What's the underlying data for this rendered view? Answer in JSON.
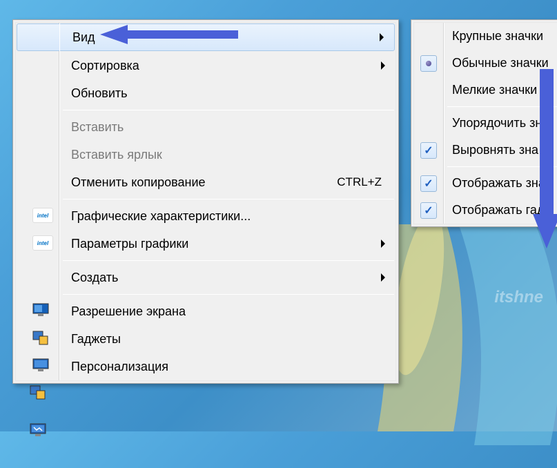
{
  "desktop_icons": {
    "intel1": "intel",
    "intel2": "intel"
  },
  "context_menu": {
    "items": [
      {
        "label": "Вид",
        "submenu": true,
        "highlighted": true
      },
      {
        "label": "Сортировка",
        "submenu": true
      },
      {
        "label": "Обновить"
      },
      {
        "separator": true
      },
      {
        "label": "Вставить",
        "disabled": true
      },
      {
        "label": "Вставить ярлык",
        "disabled": true
      },
      {
        "label": "Отменить копирование",
        "shortcut": "CTRL+Z"
      },
      {
        "separator": true
      },
      {
        "label": "Графические характеристики...",
        "icon": "intel"
      },
      {
        "label": "Параметры графики",
        "submenu": true,
        "icon": "intel"
      },
      {
        "separator": true
      },
      {
        "label": "Создать",
        "submenu": true
      },
      {
        "separator": true
      },
      {
        "label": "Разрешение экрана",
        "icon": "monitor-blue"
      },
      {
        "label": "Гаджеты",
        "icon": "gadgets"
      },
      {
        "label": "Персонализация",
        "icon": "personalize"
      }
    ]
  },
  "submenu": {
    "items": [
      {
        "label": "Крупные значки"
      },
      {
        "label": "Обычные значки",
        "radio": true
      },
      {
        "label": "Мелкие значки"
      },
      {
        "separator": true
      },
      {
        "label": "Упорядочить зн"
      },
      {
        "label": "Выровнять зна",
        "check": true
      },
      {
        "separator": true
      },
      {
        "label": "Отображать знач",
        "check": true
      },
      {
        "label": "Отображать гад",
        "check": true
      }
    ]
  },
  "watermark": "itshne"
}
